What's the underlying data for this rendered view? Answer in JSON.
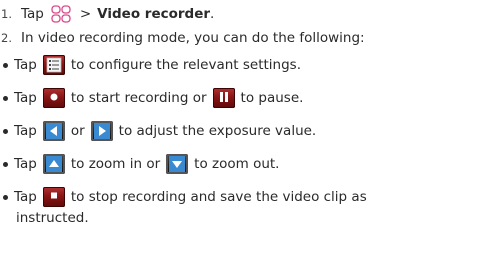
{
  "steps": [
    {
      "num": "1.",
      "pre": "Tap",
      "sep": ">",
      "bold": "Video recorder",
      "end": "."
    },
    {
      "num": "2.",
      "text": "In video recording mode, you can do the following:"
    }
  ],
  "bullets": {
    "settings": {
      "pre": "Tap",
      "post": "to configure the relevant settings."
    },
    "record": {
      "pre": "Tap",
      "mid": "to start recording or",
      "post": "to pause."
    },
    "exposure": {
      "pre": "Tap",
      "mid": "or",
      "post": "to adjust the exposure value."
    },
    "zoom": {
      "pre": "Tap",
      "mid": "to zoom in or",
      "post": "to zoom out."
    },
    "stop": {
      "pre": "Tap",
      "post": "to stop recording and save the video clip as",
      "post2": "instructed."
    }
  },
  "icons": {
    "menu": "grid-icon",
    "settings": "settings-list-icon",
    "record": "record-icon",
    "pause": "pause-icon",
    "exposure_down": "left-arrow-icon",
    "exposure_up": "right-arrow-icon",
    "zoom_in": "up-arrow-icon",
    "zoom_out": "down-arrow-icon",
    "stop": "stop-icon"
  },
  "colors": {
    "text": "#2a2a2a",
    "icon_grid": "#d9488c",
    "button": "#8a1515"
  }
}
